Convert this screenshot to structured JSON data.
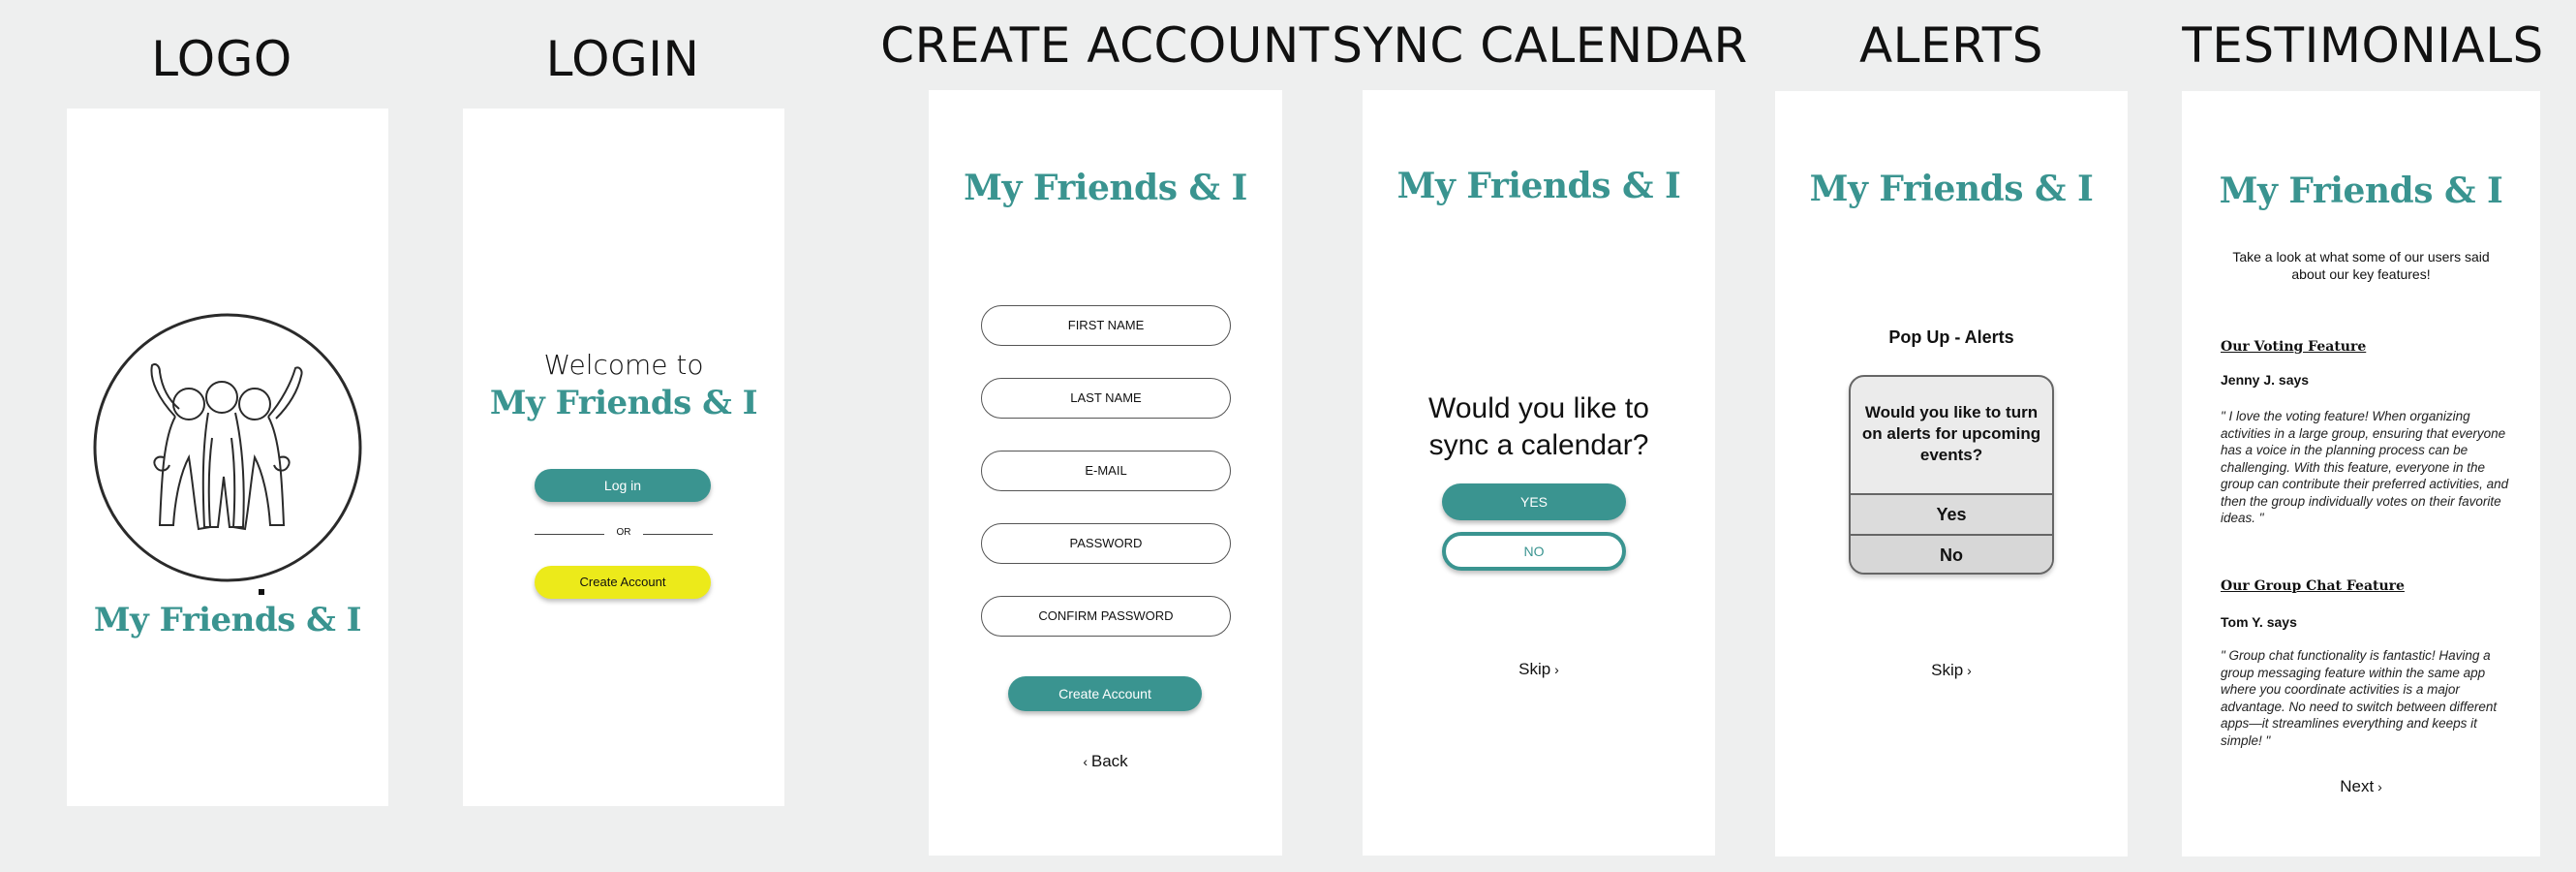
{
  "columns": {
    "logo": "LOGO",
    "login": "LOGIN",
    "create": "CREATE ACCOUNT",
    "sync": "SYNC CALENDAR",
    "alerts": "ALERTS",
    "testimonials": "TESTIMONIALS"
  },
  "brand": "My Friends & I",
  "login": {
    "welcome": "Welcome to",
    "login_button": "Log in",
    "or": "OR",
    "create_button": "Create Account"
  },
  "create": {
    "fields": {
      "first_name": "FIRST NAME",
      "last_name": "LAST NAME",
      "email": "E-MAIL",
      "password": "PASSWORD",
      "confirm_password": "CONFIRM PASSWORD"
    },
    "submit": "Create Account",
    "back": "Back"
  },
  "sync": {
    "question": "Would you like to sync a calendar?",
    "yes": "YES",
    "no": "NO",
    "skip": "Skip"
  },
  "alerts": {
    "heading": "Pop Up - Alerts",
    "dialog_text": "Would you like to turn on alerts for upcoming events?",
    "yes": "Yes",
    "no": "No",
    "skip": "Skip"
  },
  "testimonials": {
    "intro": "Take a look at what some of our users said about our key features!",
    "items": [
      {
        "feature": "Our Voting Feature",
        "author": "Jenny J. says",
        "quote": "\" I love the voting feature! When organizing activities in a large group, ensuring that everyone has a voice in the planning process can be challenging. With this feature, everyone in the group can contribute their preferred activities, and then the group individually votes on their favorite ideas. \""
      },
      {
        "feature": "Our Group Chat Feature",
        "author": "Tom Y. says",
        "quote": "\" Group chat functionality is fantastic! Having a group messaging feature within the same app where you coordinate activities is a major advantage. No need to switch between different apps—it streamlines everything and keeps it simple! \""
      }
    ],
    "next": "Next"
  },
  "colors": {
    "brand_teal": "#3a9490",
    "accent_yellow": "#ecea1a",
    "background": "#eeefef"
  }
}
